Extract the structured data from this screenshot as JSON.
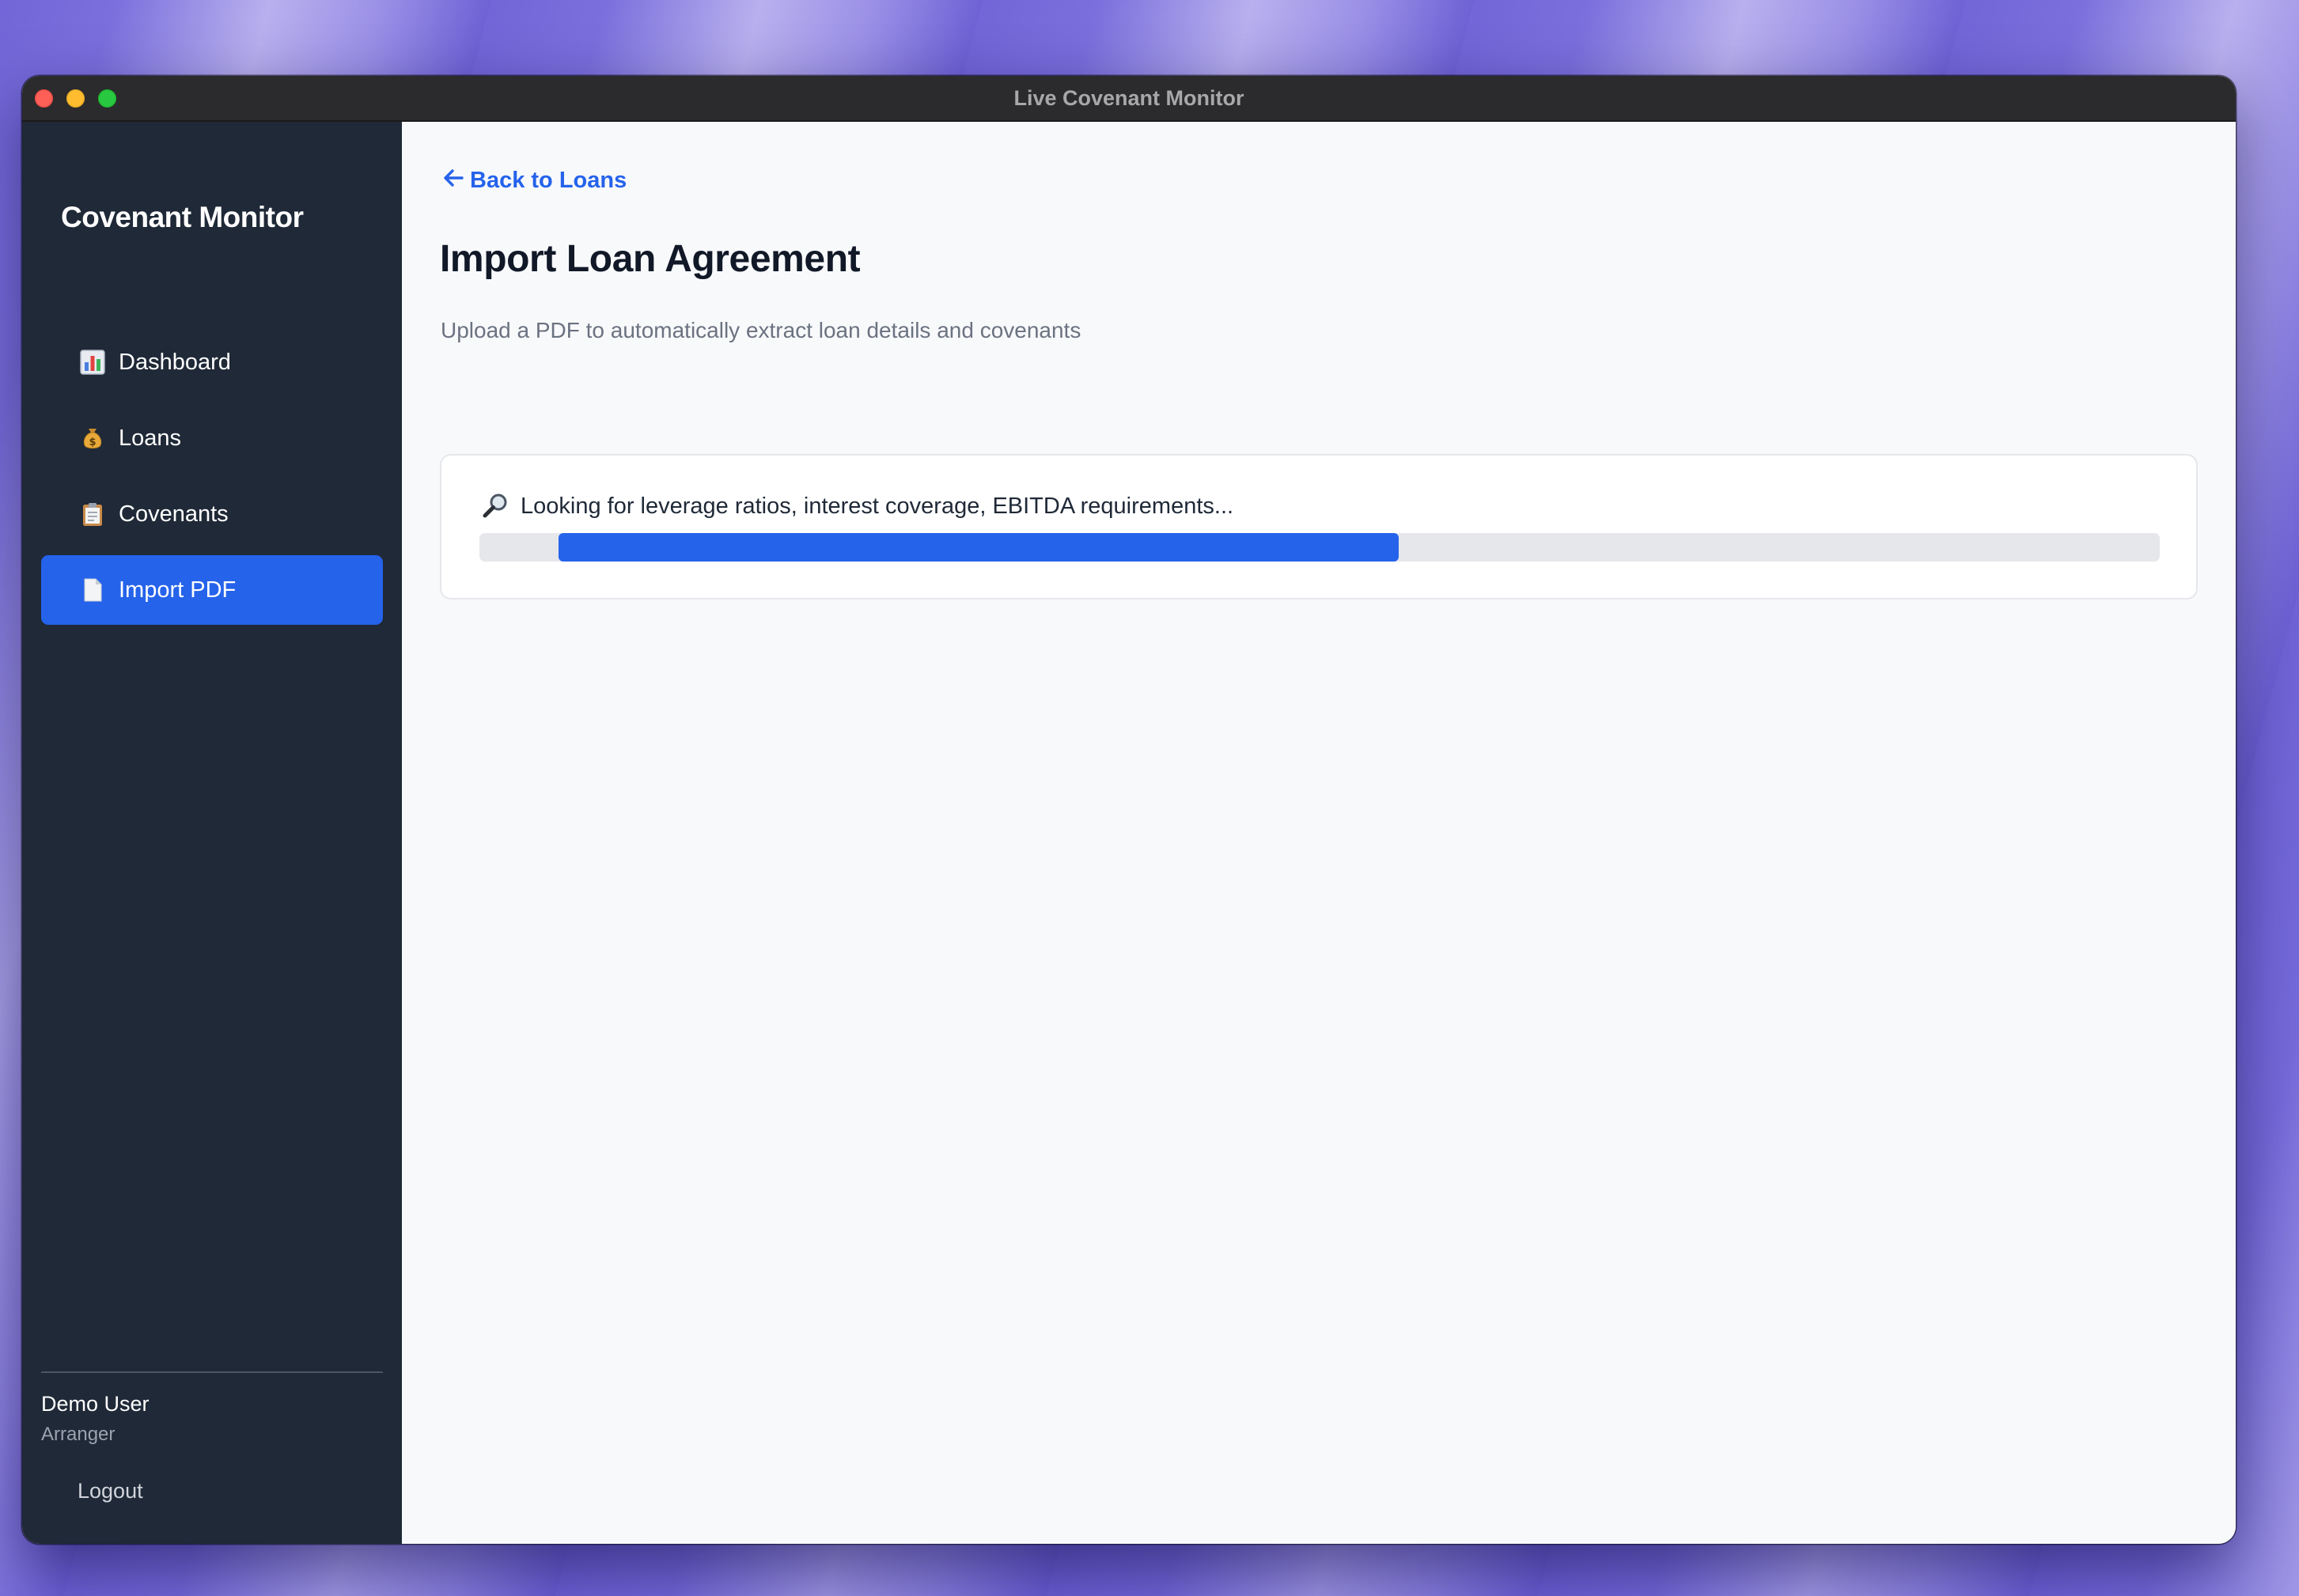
{
  "window": {
    "title": "Live Covenant Monitor"
  },
  "sidebar": {
    "brand": "Covenant Monitor",
    "items": [
      {
        "label": "Dashboard",
        "icon": "bar-chart-icon",
        "active": false
      },
      {
        "label": "Loans",
        "icon": "money-bag-icon",
        "active": false
      },
      {
        "label": "Covenants",
        "icon": "clipboard-icon",
        "active": false
      },
      {
        "label": "Import PDF",
        "icon": "document-icon",
        "active": true
      }
    ],
    "user": {
      "name": "Demo User",
      "role": "Arranger"
    },
    "logout_label": "Logout"
  },
  "main": {
    "back_link": "Back to Loans",
    "title": "Import Loan Agreement",
    "subtitle": "Upload a PDF to automatically extract loan details and covenants",
    "progress": {
      "status_icon": "magnifier-icon",
      "status_text": "Looking for leverage ratios, interest coverage, EBITDA requirements...",
      "fill_start_fraction": 0.047,
      "fill_end_fraction": 0.547
    }
  },
  "colors": {
    "accent": "#2563eb",
    "sidebar_bg": "#1f2937",
    "main_bg": "#f8f9fb",
    "progress_track": "#e5e7eb"
  }
}
